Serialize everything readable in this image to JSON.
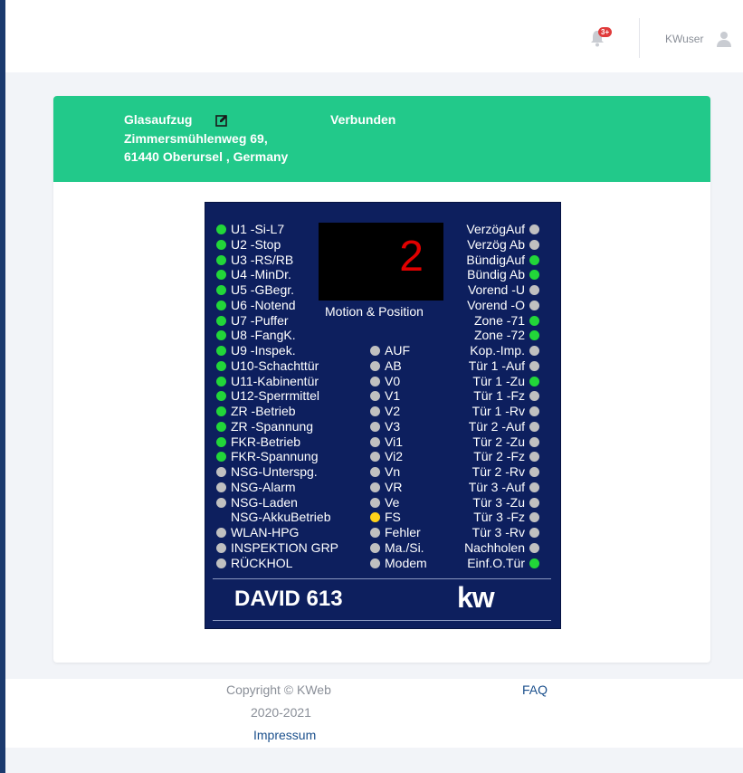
{
  "topbar": {
    "notification_badge": "3+",
    "username": "KWuser"
  },
  "site": {
    "title": "Glasaufzug",
    "status": "Verbunden",
    "address_line1": "Zimmersmühlenweg 69,",
    "address_line2": "61440 Oberursel , Germany"
  },
  "panel": {
    "display_value": "2",
    "display_label": "Motion & Position",
    "model": "DAVID 613",
    "logo_text": "kw",
    "colors": {
      "on": "#22d639",
      "off": "#c0c0c0",
      "warn": "#ffd21a"
    },
    "left": [
      {
        "label": "U1  -Si-L7",
        "state": "on"
      },
      {
        "label": "U2  -Stop",
        "state": "on"
      },
      {
        "label": "U3  -RS/RB",
        "state": "on"
      },
      {
        "label": "U4  -MinDr.",
        "state": "on"
      },
      {
        "label": "U5  -GBegr.",
        "state": "on"
      },
      {
        "label": "U6  -Notend",
        "state": "on"
      },
      {
        "label": "U7  -Puffer",
        "state": "on"
      },
      {
        "label": "U8  -FangK.",
        "state": "on"
      },
      {
        "label": "U9  -Inspek.",
        "state": "on"
      },
      {
        "label": "U10-Schachttür",
        "state": "on"
      },
      {
        "label": "U11-Kabinentür",
        "state": "on"
      },
      {
        "label": "U12-Sperrmittel",
        "state": "on"
      },
      {
        "label": "ZR  -Betrieb",
        "state": "on"
      },
      {
        "label": "ZR  -Spannung",
        "state": "on"
      },
      {
        "label": "FKR-Betrieb",
        "state": "on"
      },
      {
        "label": "FKR-Spannung",
        "state": "on"
      },
      {
        "label": "NSG-Unterspg.",
        "state": "off"
      },
      {
        "label": "NSG-Alarm",
        "state": "off"
      },
      {
        "label": "NSG-Laden",
        "state": "off"
      },
      {
        "label": "NSG-AkkuBetrieb",
        "state": "none"
      },
      {
        "label": "WLAN-HPG",
        "state": "off"
      },
      {
        "label": "INSPEKTION GRP",
        "state": "off"
      },
      {
        "label": "RÜCKHOL",
        "state": "off"
      }
    ],
    "middle": [
      {
        "label": "AUF",
        "state": "off"
      },
      {
        "label": "AB",
        "state": "off"
      },
      {
        "label": "V0",
        "state": "off"
      },
      {
        "label": "V1",
        "state": "off"
      },
      {
        "label": "V2",
        "state": "off"
      },
      {
        "label": "V3",
        "state": "off"
      },
      {
        "label": "Vi1",
        "state": "off"
      },
      {
        "label": "Vi2",
        "state": "off"
      },
      {
        "label": "Vn",
        "state": "off"
      },
      {
        "label": "VR",
        "state": "off"
      },
      {
        "label": "Ve",
        "state": "off"
      },
      {
        "label": "FS",
        "state": "warn"
      },
      {
        "label": "Fehler",
        "state": "off"
      },
      {
        "label": "Ma./Si.",
        "state": "off"
      },
      {
        "label": "Modem",
        "state": "off"
      }
    ],
    "right": [
      {
        "label": "VerzögAuf",
        "state": "off"
      },
      {
        "label": "Verzög Ab",
        "state": "off"
      },
      {
        "label": "BündigAuf",
        "state": "on"
      },
      {
        "label": "Bündig Ab",
        "state": "on"
      },
      {
        "label": "Vorend -U",
        "state": "off"
      },
      {
        "label": "Vorend -O",
        "state": "off"
      },
      {
        "label": "Zone -71",
        "state": "on"
      },
      {
        "label": "Zone -72",
        "state": "on"
      },
      {
        "label": "Kop.-Imp.",
        "state": "off"
      },
      {
        "label": "Tür 1 -Auf",
        "state": "off"
      },
      {
        "label": "Tür 1  -Zu",
        "state": "on"
      },
      {
        "label": "Tür 1  -Fz",
        "state": "off"
      },
      {
        "label": "Tür 1  -Rv",
        "state": "off"
      },
      {
        "label": "Tür 2 -Auf",
        "state": "off"
      },
      {
        "label": "Tür 2  -Zu",
        "state": "off"
      },
      {
        "label": "Tür 2  -Fz",
        "state": "off"
      },
      {
        "label": "Tür 2  -Rv",
        "state": "off"
      },
      {
        "label": "Tür 3 -Auf",
        "state": "off"
      },
      {
        "label": "Tür 3  -Zu",
        "state": "off"
      },
      {
        "label": "Tür 3  -Fz",
        "state": "off"
      },
      {
        "label": "Tür 3  -Rv",
        "state": "off"
      },
      {
        "label": "Nachholen",
        "state": "off"
      },
      {
        "label": "Einf.O.Tür",
        "state": "on"
      }
    ]
  },
  "footer": {
    "copyright": "Copyright © KWeb",
    "years": "2020-2021",
    "impressum": "Impressum",
    "faq": "FAQ"
  }
}
